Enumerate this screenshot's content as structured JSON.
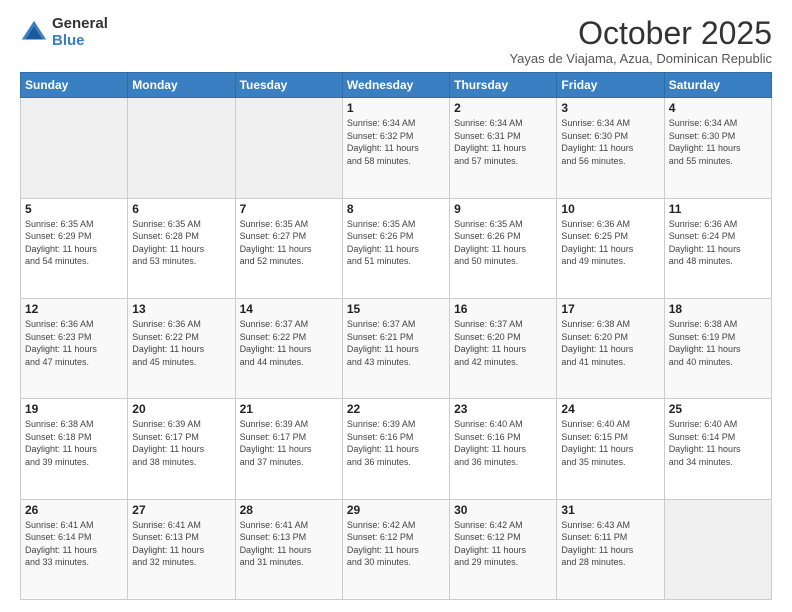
{
  "logo": {
    "general": "General",
    "blue": "Blue"
  },
  "header": {
    "month": "October 2025",
    "location": "Yayas de Viajama, Azua, Dominican Republic"
  },
  "weekdays": [
    "Sunday",
    "Monday",
    "Tuesday",
    "Wednesday",
    "Thursday",
    "Friday",
    "Saturday"
  ],
  "weeks": [
    [
      {
        "day": "",
        "info": ""
      },
      {
        "day": "",
        "info": ""
      },
      {
        "day": "",
        "info": ""
      },
      {
        "day": "1",
        "info": "Sunrise: 6:34 AM\nSunset: 6:32 PM\nDaylight: 11 hours\nand 58 minutes."
      },
      {
        "day": "2",
        "info": "Sunrise: 6:34 AM\nSunset: 6:31 PM\nDaylight: 11 hours\nand 57 minutes."
      },
      {
        "day": "3",
        "info": "Sunrise: 6:34 AM\nSunset: 6:30 PM\nDaylight: 11 hours\nand 56 minutes."
      },
      {
        "day": "4",
        "info": "Sunrise: 6:34 AM\nSunset: 6:30 PM\nDaylight: 11 hours\nand 55 minutes."
      }
    ],
    [
      {
        "day": "5",
        "info": "Sunrise: 6:35 AM\nSunset: 6:29 PM\nDaylight: 11 hours\nand 54 minutes."
      },
      {
        "day": "6",
        "info": "Sunrise: 6:35 AM\nSunset: 6:28 PM\nDaylight: 11 hours\nand 53 minutes."
      },
      {
        "day": "7",
        "info": "Sunrise: 6:35 AM\nSunset: 6:27 PM\nDaylight: 11 hours\nand 52 minutes."
      },
      {
        "day": "8",
        "info": "Sunrise: 6:35 AM\nSunset: 6:26 PM\nDaylight: 11 hours\nand 51 minutes."
      },
      {
        "day": "9",
        "info": "Sunrise: 6:35 AM\nSunset: 6:26 PM\nDaylight: 11 hours\nand 50 minutes."
      },
      {
        "day": "10",
        "info": "Sunrise: 6:36 AM\nSunset: 6:25 PM\nDaylight: 11 hours\nand 49 minutes."
      },
      {
        "day": "11",
        "info": "Sunrise: 6:36 AM\nSunset: 6:24 PM\nDaylight: 11 hours\nand 48 minutes."
      }
    ],
    [
      {
        "day": "12",
        "info": "Sunrise: 6:36 AM\nSunset: 6:23 PM\nDaylight: 11 hours\nand 47 minutes."
      },
      {
        "day": "13",
        "info": "Sunrise: 6:36 AM\nSunset: 6:22 PM\nDaylight: 11 hours\nand 45 minutes."
      },
      {
        "day": "14",
        "info": "Sunrise: 6:37 AM\nSunset: 6:22 PM\nDaylight: 11 hours\nand 44 minutes."
      },
      {
        "day": "15",
        "info": "Sunrise: 6:37 AM\nSunset: 6:21 PM\nDaylight: 11 hours\nand 43 minutes."
      },
      {
        "day": "16",
        "info": "Sunrise: 6:37 AM\nSunset: 6:20 PM\nDaylight: 11 hours\nand 42 minutes."
      },
      {
        "day": "17",
        "info": "Sunrise: 6:38 AM\nSunset: 6:20 PM\nDaylight: 11 hours\nand 41 minutes."
      },
      {
        "day": "18",
        "info": "Sunrise: 6:38 AM\nSunset: 6:19 PM\nDaylight: 11 hours\nand 40 minutes."
      }
    ],
    [
      {
        "day": "19",
        "info": "Sunrise: 6:38 AM\nSunset: 6:18 PM\nDaylight: 11 hours\nand 39 minutes."
      },
      {
        "day": "20",
        "info": "Sunrise: 6:39 AM\nSunset: 6:17 PM\nDaylight: 11 hours\nand 38 minutes."
      },
      {
        "day": "21",
        "info": "Sunrise: 6:39 AM\nSunset: 6:17 PM\nDaylight: 11 hours\nand 37 minutes."
      },
      {
        "day": "22",
        "info": "Sunrise: 6:39 AM\nSunset: 6:16 PM\nDaylight: 11 hours\nand 36 minutes."
      },
      {
        "day": "23",
        "info": "Sunrise: 6:40 AM\nSunset: 6:16 PM\nDaylight: 11 hours\nand 36 minutes."
      },
      {
        "day": "24",
        "info": "Sunrise: 6:40 AM\nSunset: 6:15 PM\nDaylight: 11 hours\nand 35 minutes."
      },
      {
        "day": "25",
        "info": "Sunrise: 6:40 AM\nSunset: 6:14 PM\nDaylight: 11 hours\nand 34 minutes."
      }
    ],
    [
      {
        "day": "26",
        "info": "Sunrise: 6:41 AM\nSunset: 6:14 PM\nDaylight: 11 hours\nand 33 minutes."
      },
      {
        "day": "27",
        "info": "Sunrise: 6:41 AM\nSunset: 6:13 PM\nDaylight: 11 hours\nand 32 minutes."
      },
      {
        "day": "28",
        "info": "Sunrise: 6:41 AM\nSunset: 6:13 PM\nDaylight: 11 hours\nand 31 minutes."
      },
      {
        "day": "29",
        "info": "Sunrise: 6:42 AM\nSunset: 6:12 PM\nDaylight: 11 hours\nand 30 minutes."
      },
      {
        "day": "30",
        "info": "Sunrise: 6:42 AM\nSunset: 6:12 PM\nDaylight: 11 hours\nand 29 minutes."
      },
      {
        "day": "31",
        "info": "Sunrise: 6:43 AM\nSunset: 6:11 PM\nDaylight: 11 hours\nand 28 minutes."
      },
      {
        "day": "",
        "info": ""
      }
    ]
  ]
}
